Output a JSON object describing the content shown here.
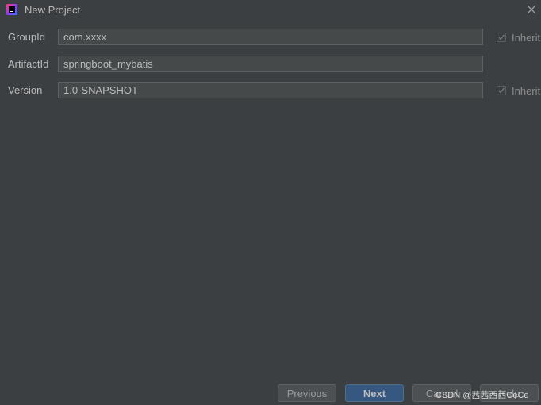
{
  "window": {
    "title": "New Project",
    "icon": "intellij-logo-icon",
    "close_icon": "close-icon"
  },
  "form": {
    "group_id": {
      "label": "GroupId",
      "value": "com.xxxx",
      "inherit_label": "Inherit",
      "inherit_checked": true
    },
    "artifact_id": {
      "label": "ArtifactId",
      "value": "springboot_mybatis"
    },
    "version": {
      "label": "Version",
      "value": "1.0-SNAPSHOT",
      "inherit_label": "Inherit",
      "inherit_checked": true
    }
  },
  "buttons": {
    "previous": "Previous",
    "next": "Next",
    "cancel": "Cancel",
    "help": "Help"
  },
  "watermark": "CSDN @茜茜西西CeCe",
  "colors": {
    "background": "#3c3f41",
    "field": "#45494a",
    "primary_button": "#365880"
  }
}
